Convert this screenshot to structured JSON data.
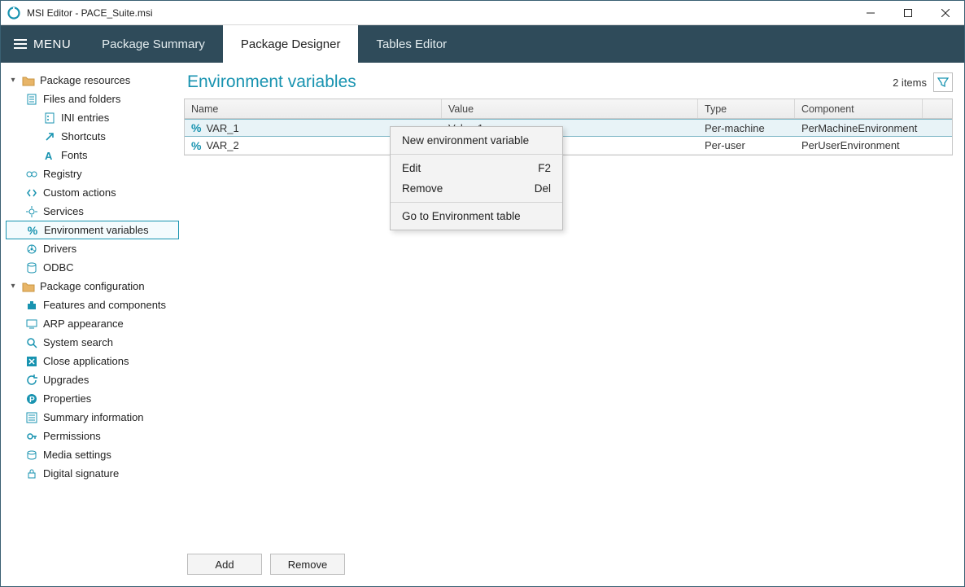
{
  "window": {
    "title": "MSI Editor - PACE_Suite.msi"
  },
  "menu": {
    "label": "MENU"
  },
  "tabs": {
    "summary": "Package Summary",
    "designer": "Package Designer",
    "tables": "Tables Editor"
  },
  "sidebar": {
    "resources": {
      "label": "Package resources",
      "files": "Files and folders",
      "ini": "INI entries",
      "shortcuts": "Shortcuts",
      "fonts": "Fonts",
      "registry": "Registry",
      "custom": "Custom actions",
      "services": "Services",
      "env": "Environment variables",
      "drivers": "Drivers",
      "odbc": "ODBC"
    },
    "config": {
      "label": "Package configuration",
      "features": "Features and components",
      "arp": "ARP appearance",
      "search": "System search",
      "closeapps": "Close applications",
      "upgrades": "Upgrades",
      "properties": "Properties",
      "summaryinfo": "Summary information",
      "permissions": "Permissions",
      "media": "Media settings",
      "digital": "Digital signature"
    }
  },
  "panel": {
    "title": "Environment variables",
    "count": "2 items"
  },
  "table": {
    "headers": {
      "name": "Name",
      "value": "Value",
      "type": "Type",
      "component": "Component"
    },
    "rows": [
      {
        "name": "VAR_1",
        "value": "Value 1",
        "type": "Per-machine",
        "component": "PerMachineEnvironment"
      },
      {
        "name": "VAR_2",
        "value": "",
        "type": "Per-user",
        "component": "PerUserEnvironment"
      }
    ]
  },
  "context": {
    "newvar": "New environment variable",
    "edit": "Edit",
    "edit_sc": "F2",
    "remove": "Remove",
    "remove_sc": "Del",
    "goto": "Go to Environment table"
  },
  "footer": {
    "add": "Add",
    "remove": "Remove"
  }
}
